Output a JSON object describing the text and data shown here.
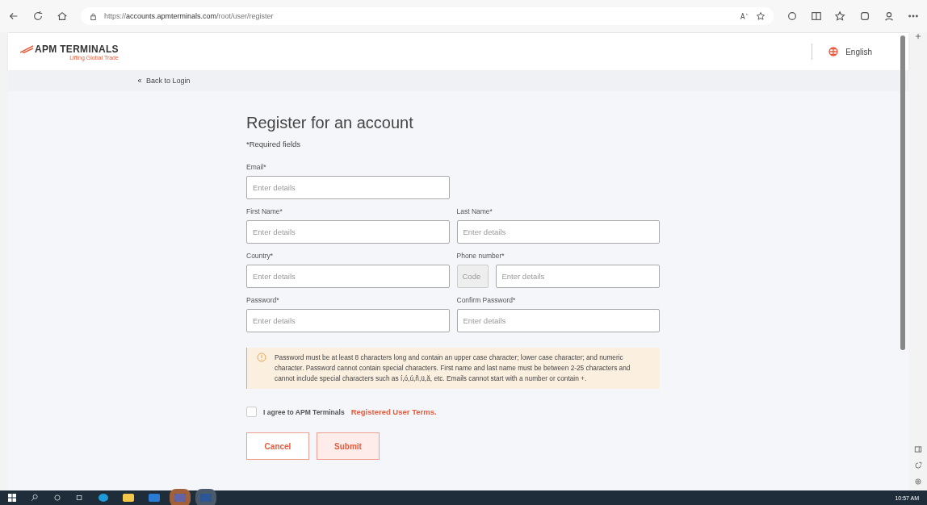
{
  "browser": {
    "url": "https://**accounts.apmterminals.com**/root/user/register"
  },
  "header": {
    "logo": "APM TERMINALS",
    "tagline": "Lifting Global Trade",
    "language": "English"
  },
  "back_link": "Back to Login",
  "form": {
    "title": "Register for an account",
    "required_note": "*Required fields",
    "rows": [
      [
        {
          "kind": "text",
          "label": "Email*",
          "placeholder": "Enter details"
        }
      ],
      [
        {
          "kind": "text",
          "label": "First Name*",
          "placeholder": "Enter details"
        },
        {
          "kind": "text",
          "label": "Last Name*",
          "placeholder": "Enter details"
        }
      ],
      [
        {
          "kind": "text",
          "label": "Country*",
          "placeholder": "Enter details"
        },
        {
          "kind": "phone",
          "label": "Phone number*",
          "code_placeholder": "Code",
          "placeholder": "Enter details"
        }
      ],
      [
        {
          "kind": "text",
          "label": "Password*",
          "placeholder": "Enter details"
        },
        {
          "kind": "text",
          "label": "Confirm Password*",
          "placeholder": "Enter details"
        }
      ]
    ],
    "notice": "Password must be at least 8 characters long and contain an upper case character; lower case character; and numeric character. Password cannot contain special characters. First name and last name must be between 2-25 characters and cannot include special characters such as í,ó,ú,ñ,ü,ă, etc. Emails cannot start with a number or contain +.",
    "agree": {
      "checked": false,
      "text": "I agree to APM Terminals",
      "link": "Registered User Terms."
    },
    "buttons": [
      {
        "kind": "secondary",
        "label": "Cancel"
      },
      {
        "kind": "primary",
        "label": "Submit"
      }
    ]
  },
  "taskbar": {
    "clock": "10:57 AM"
  }
}
